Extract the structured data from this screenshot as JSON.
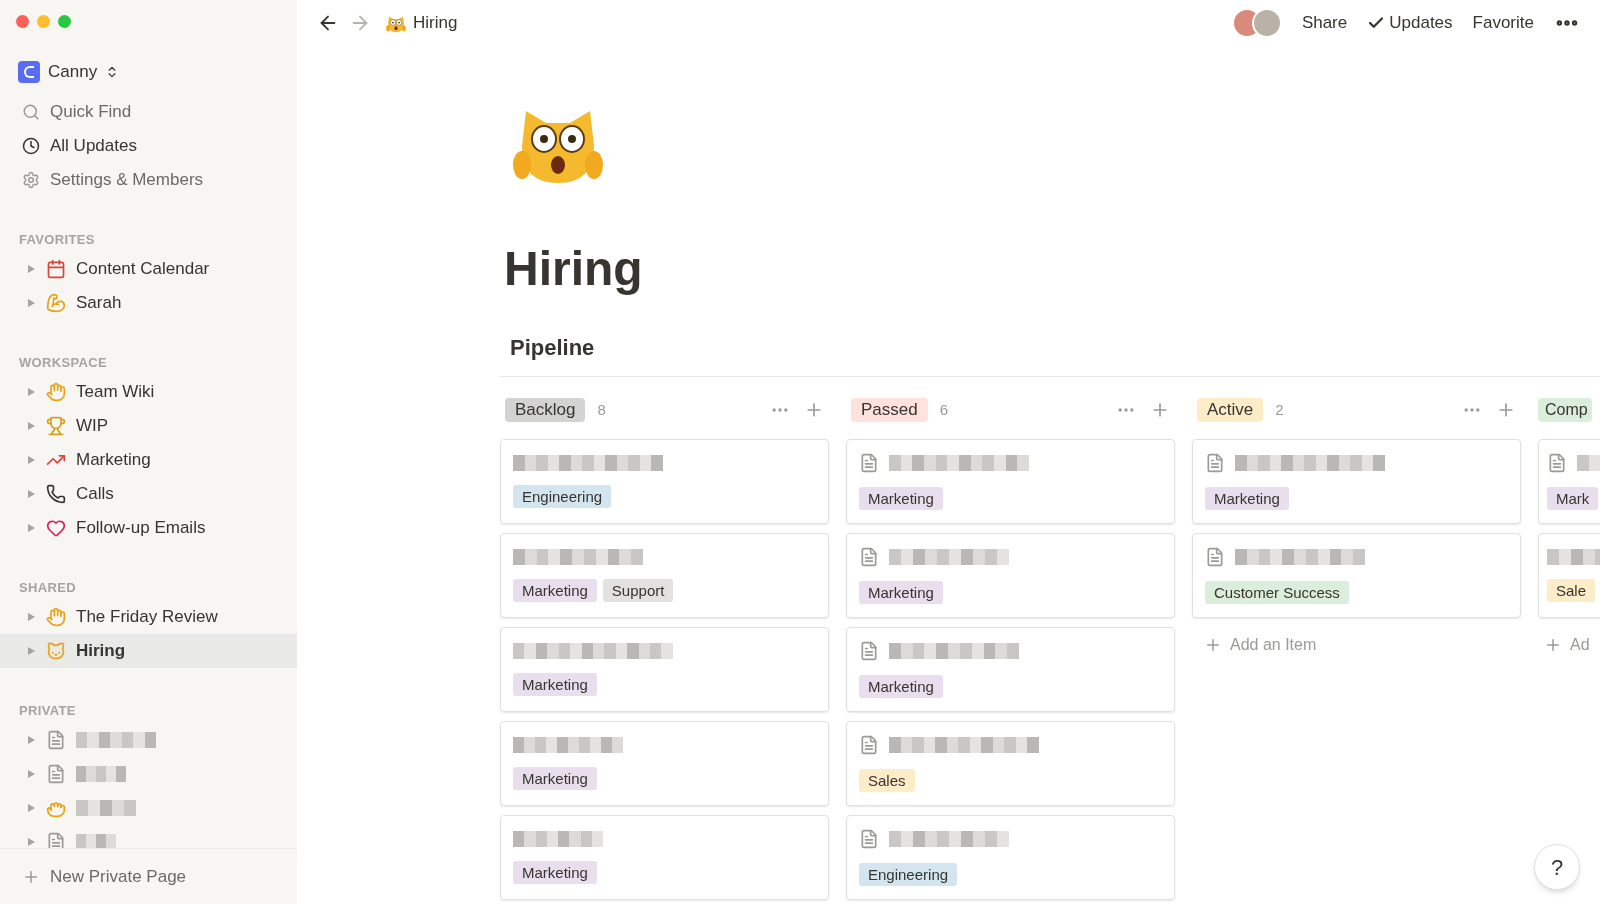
{
  "sidebar": {
    "workspace": "Canny",
    "nav": [
      {
        "label": "Quick Find",
        "selected": false
      },
      {
        "label": "All Updates",
        "selected": true
      },
      {
        "label": "Settings & Members",
        "selected": false
      }
    ],
    "sections": [
      {
        "title": "FAVORITES",
        "items": [
          {
            "kind": "page",
            "label": "Content Calendar",
            "selected": false
          },
          {
            "kind": "page",
            "label": "Sarah",
            "selected": false
          }
        ]
      },
      {
        "title": "WORKSPACE",
        "items": [
          {
            "kind": "page",
            "label": "Team Wiki",
            "selected": false
          },
          {
            "kind": "page",
            "label": "WIP",
            "selected": false
          },
          {
            "kind": "page",
            "label": "Marketing",
            "selected": false
          },
          {
            "kind": "page",
            "label": "Calls",
            "selected": false
          },
          {
            "kind": "page",
            "label": "Follow-up Emails",
            "selected": false
          }
        ]
      },
      {
        "title": "SHARED",
        "items": [
          {
            "kind": "page",
            "label": "The Friday Review",
            "selected": false
          },
          {
            "kind": "page",
            "label": "Hiring",
            "selected": true
          }
        ]
      },
      {
        "title": "PRIVATE",
        "items": [
          {
            "kind": "redacted",
            "selected": false
          },
          {
            "kind": "redacted",
            "selected": false
          },
          {
            "kind": "redacted",
            "selected": false
          },
          {
            "kind": "redacted",
            "selected": false
          }
        ]
      }
    ],
    "new_page": "New Private Page"
  },
  "topbar": {
    "breadcrumb": "Hiring",
    "actions": [
      "Share",
      "Updates",
      "Favorite"
    ]
  },
  "page": {
    "title": "Hiring",
    "view": "Pipeline",
    "columns": [
      {
        "name": "Backlog",
        "color": "#d3d3d1",
        "count": "8",
        "cards": [
          {
            "page_icon": false,
            "tags": [
              {
                "label": "Engineering",
                "color": "#d3e5ef"
              }
            ]
          },
          {
            "page_icon": false,
            "tags": [
              {
                "label": "Marketing",
                "color": "#e8deee"
              },
              {
                "label": "Support",
                "color": "#e3e2e0"
              }
            ]
          },
          {
            "page_icon": false,
            "tags": [
              {
                "label": "Marketing",
                "color": "#e8deee"
              }
            ]
          },
          {
            "page_icon": false,
            "tags": [
              {
                "label": "Marketing",
                "color": "#e8deee"
              }
            ]
          },
          {
            "page_icon": false,
            "tags": [
              {
                "label": "Marketing",
                "color": "#e8deee"
              }
            ]
          }
        ]
      },
      {
        "name": "Passed",
        "color": "#ffe2dd",
        "count": "6",
        "cards": [
          {
            "page_icon": true,
            "tags": [
              {
                "label": "Marketing",
                "color": "#e8deee"
              }
            ]
          },
          {
            "page_icon": true,
            "tags": [
              {
                "label": "Marketing",
                "color": "#e8deee"
              }
            ]
          },
          {
            "page_icon": true,
            "tags": [
              {
                "label": "Marketing",
                "color": "#e8deee"
              }
            ]
          },
          {
            "page_icon": true,
            "tags": [
              {
                "label": "Sales",
                "color": "#fdecc8"
              }
            ]
          },
          {
            "page_icon": true,
            "tags": [
              {
                "label": "Engineering",
                "color": "#d3e5ef"
              }
            ]
          }
        ]
      },
      {
        "name": "Active",
        "color": "#fdecc8",
        "count": "2",
        "add_label": "Add an Item",
        "cards": [
          {
            "page_icon": true,
            "tags": [
              {
                "label": "Marketing",
                "color": "#e8deee"
              }
            ]
          },
          {
            "page_icon": true,
            "tags": [
              {
                "label": "Customer Success",
                "color": "#dbeddb"
              }
            ]
          }
        ]
      },
      {
        "name": "Comp",
        "color": "#dbeddb",
        "add_label": "Ad",
        "cards": [
          {
            "page_icon": true,
            "tags": [
              {
                "label": "Mark",
                "color": "#e8deee"
              }
            ]
          },
          {
            "page_icon": false,
            "tags": [
              {
                "label": "Sale",
                "color": "#fdecc8"
              }
            ]
          }
        ]
      }
    ]
  },
  "help": "?"
}
